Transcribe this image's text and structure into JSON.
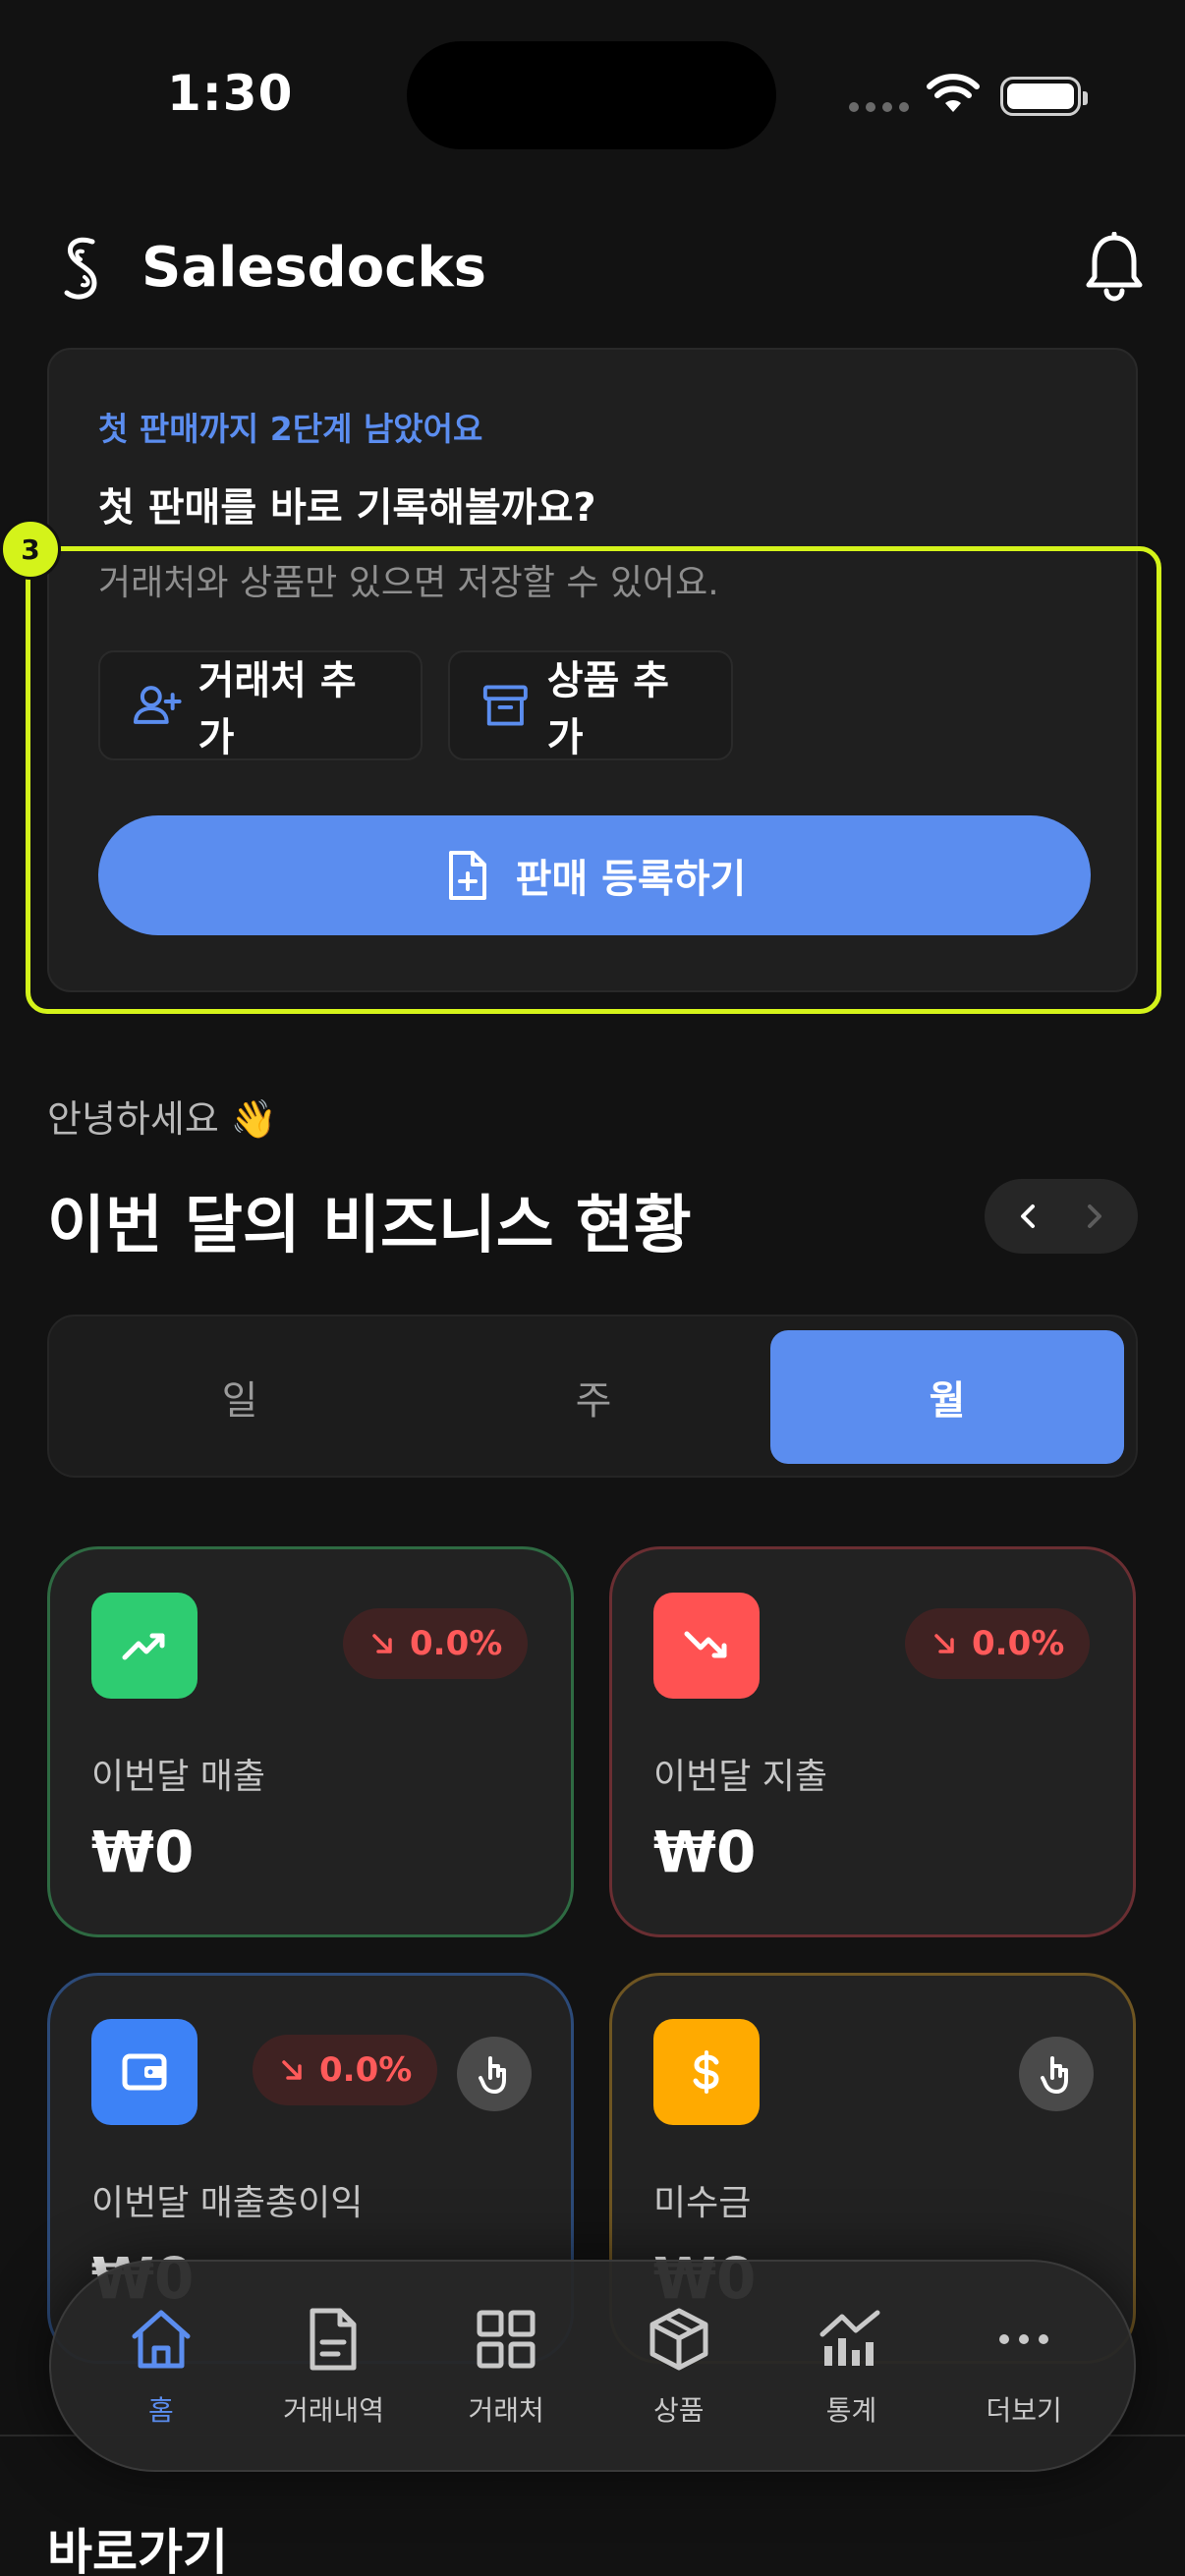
{
  "status_bar": {
    "time": "1:30"
  },
  "header": {
    "app_name": "Salesdocks"
  },
  "onboarding": {
    "step_text": "첫 판매까지 2단계 남았어요",
    "title": "첫 판매를 바로 기록해볼까요?",
    "subtitle": "거래처와 상품만 있으면 저장할 수 있어요.",
    "add_client_label": "거래처 추가",
    "add_product_label": "상품 추가",
    "register_sale_label": "판매 등록하기"
  },
  "annotation": {
    "badge": "3",
    "color": "#d4f31a"
  },
  "greeting": "안녕하세요 👋",
  "section_title": "이번 달의 비즈니스 현황",
  "period_tabs": {
    "day": "일",
    "week": "주",
    "month": "월",
    "selected": "월"
  },
  "stats": {
    "revenue": {
      "label": "이번달 매출",
      "value": "₩0",
      "delta": "0.0%",
      "color": "#2ecc71"
    },
    "expense": {
      "label": "이번달 지출",
      "value": "₩0",
      "delta": "0.0%",
      "color": "#ff5252"
    },
    "gross_profit": {
      "label": "이번달 매출총이익",
      "value": "₩0",
      "delta": "0.0%",
      "color": "#3d82f6"
    },
    "receivables": {
      "label": "미수금",
      "value": "₩0",
      "color": "#ffaa00"
    }
  },
  "tabs": {
    "home": "홈",
    "transactions": "거래내역",
    "clients": "거래처",
    "products": "상품",
    "statistics": "통계",
    "more": "더보기",
    "active": "홈"
  },
  "shortcuts_title": "바로가기",
  "colors": {
    "accent": "#5b8def",
    "background": "#121212",
    "card": "#1f1f1f",
    "negative": "#ff5a5a"
  }
}
